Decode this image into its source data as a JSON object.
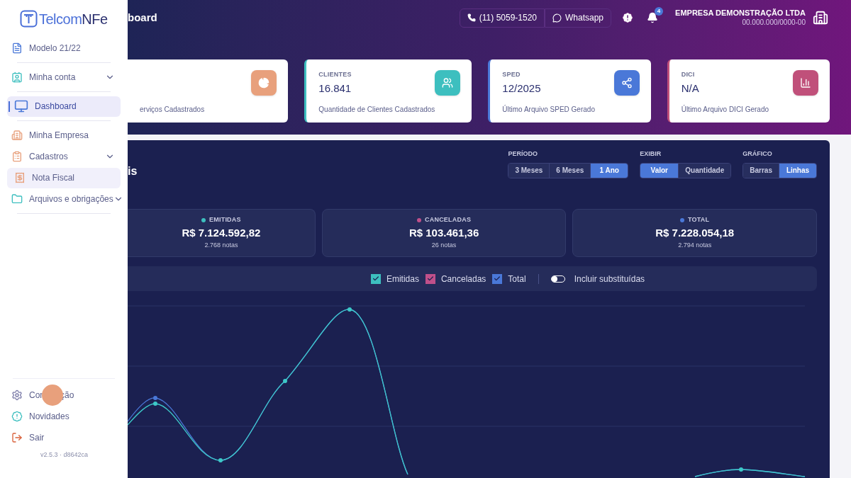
{
  "sidebar": {
    "logo": {
      "prefix": "Telcom",
      "suffix": "NFe"
    },
    "items": [
      {
        "label": "Modelo 21/22",
        "selected": false,
        "hovered": false,
        "expandable": false,
        "divider_after": true
      },
      {
        "label": "Minha conta",
        "selected": false,
        "hovered": false,
        "expandable": true,
        "divider_after": true
      },
      {
        "label": "Dashboard",
        "selected": true,
        "hovered": false,
        "expandable": false,
        "divider_after": true
      },
      {
        "label": "Minha Empresa",
        "selected": false,
        "hovered": false,
        "expandable": false,
        "divider_after": false
      },
      {
        "label": "Cadastros",
        "selected": false,
        "hovered": false,
        "expandable": true,
        "divider_after": false
      },
      {
        "label": "Nota Fiscal",
        "selected": false,
        "hovered": true,
        "expandable": false,
        "divider_after": false
      },
      {
        "label": "Arquivos e obrigações",
        "selected": false,
        "hovered": false,
        "expandable": true,
        "divider_after": true
      }
    ],
    "bottom_items": [
      {
        "label_parts": [
          "Con",
          "ção"
        ]
      },
      {
        "label_parts": [
          "Novidades"
        ]
      },
      {
        "label_parts": [
          "Sair"
        ]
      }
    ],
    "version": "v2.5.3 · d8642ca"
  },
  "header": {
    "title": "board",
    "phone": "(11) 5059-1520",
    "whatsapp": "Whatsapp",
    "notifications": "4",
    "company": "EMPRESA DEMONSTRAÇÃO LTDA",
    "cnpj": "00.000.000/0000-00"
  },
  "stat_cards": [
    {
      "caption": "erviços Cadastrados",
      "color": "#e8a07c"
    },
    {
      "label": "CLIENTES",
      "value": "16.841",
      "caption": "Quantidade de Clientes Cadastrados",
      "color": "#3dbfbf"
    },
    {
      "label": "SPED",
      "value": "12/2025",
      "caption": "Último Arquivo SPED Gerado",
      "color": "#4a78d8"
    },
    {
      "label": "DICI",
      "value": "N/A",
      "caption": "Último Arquivo DICI Gerado",
      "color": "#c0507a"
    }
  ],
  "panel": {
    "title": "is",
    "controls": [
      {
        "label": "PERÍODO",
        "options": [
          {
            "label": "3 Meses",
            "selected": false
          },
          {
            "label": "6 Meses",
            "selected": false
          },
          {
            "label": "1 Ano",
            "selected": true
          }
        ]
      },
      {
        "label": "EXIBIR",
        "options": [
          {
            "label": "Valor",
            "selected": true
          },
          {
            "label": "Quantidade",
            "selected": false
          }
        ]
      },
      {
        "label": "GRÁFICO",
        "options": [
          {
            "label": "Barras",
            "selected": false
          },
          {
            "label": "Linhas",
            "selected": true
          }
        ]
      }
    ],
    "summaries": [
      {
        "label": "EMITIDAS",
        "value": "R$ 7.124.592,82",
        "count": "2.768 notas",
        "color": "#3dbfbf"
      },
      {
        "label": "CANCELADAS",
        "value": "R$ 103.461,36",
        "count": "26 notas",
        "color": "#c0508a"
      },
      {
        "label": "TOTAL",
        "value": "R$ 7.228.054,18",
        "count": "2.794 notas",
        "color": "#4a78d8"
      }
    ],
    "legend": [
      {
        "label": "Emitidas",
        "checked": true,
        "color": "#3dbfbf"
      },
      {
        "label": "Canceladas",
        "checked": true,
        "color": "#c0508a"
      },
      {
        "label": "Total",
        "checked": true,
        "color": "#4a78d8"
      }
    ],
    "toggle": {
      "label": "Incluir substituídas",
      "on": false
    }
  }
}
